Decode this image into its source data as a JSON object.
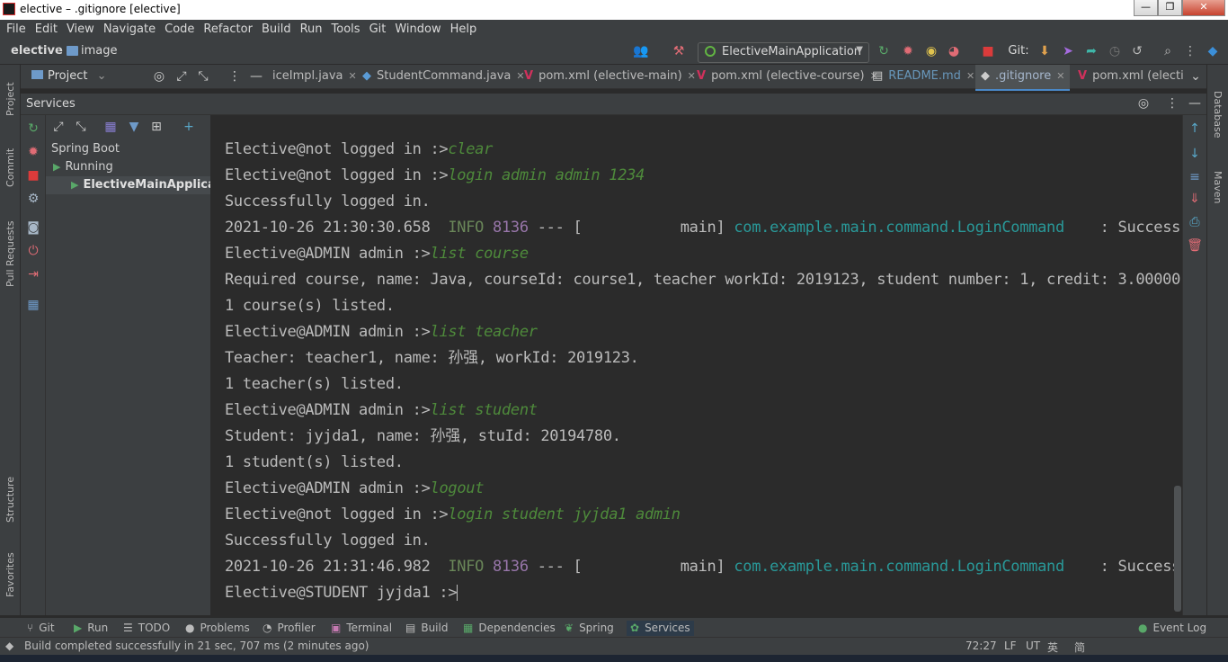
{
  "window": {
    "title": "elective – .gitignore [elective]",
    "minimize": "—",
    "maximize": "❐",
    "close": "✕"
  },
  "menu": [
    "File",
    "Edit",
    "View",
    "Navigate",
    "Code",
    "Refactor",
    "Build",
    "Run",
    "Tools",
    "Git",
    "Window",
    "Help"
  ],
  "nav": {
    "project": "elective",
    "sep": "›",
    "folder": "image",
    "run_config": "ElectiveMainApplication",
    "git_label": "Git:"
  },
  "project_panel": {
    "label": "Project"
  },
  "editor_tabs": [
    {
      "label": "iceImpl.java",
      "icon": ""
    },
    {
      "label": "StudentCommand.java",
      "icon": "◆"
    },
    {
      "label": "pom.xml (elective-main)",
      "icon": "V"
    },
    {
      "label": "pom.xml (elective-course)",
      "icon": "V"
    },
    {
      "label": "README.md",
      "icon": "▤"
    },
    {
      "label": ".gitignore",
      "icon": "◆"
    },
    {
      "label": "pom.xml (electiv",
      "icon": "V"
    }
  ],
  "left_strip": [
    "Project",
    "Commit",
    "Pull Requests",
    "Structure",
    "Favorites"
  ],
  "right_strip": [
    "Database",
    "Maven"
  ],
  "services": {
    "title": "Services",
    "tree": [
      {
        "label": "Spring Boot"
      },
      {
        "label": "Running"
      },
      {
        "label": "ElectiveMainApplicatio"
      }
    ]
  },
  "console": {
    "lines": [
      {
        "prompt": "Elective@not logged in :>",
        "cmd": "clear"
      },
      {
        "prompt": "Elective@not logged in :>",
        "cmd": "login admin admin 1234"
      },
      {
        "text": "Successfully logged in."
      },
      {
        "log_time": "2021-10-26 21:30:30.658  ",
        "log_level": "INFO",
        "log_pid": " 8136",
        "log_mid": " --- [           main] ",
        "log_class": "com.example.main.command.LoginCommand",
        "log_tail": "    : Success"
      },
      {
        "prompt": "Elective@ADMIN admin :>",
        "cmd": "list course"
      },
      {
        "text": "Required course, name: Java, courseId: course1, teacher workId: 2019123, student number: 1, credit: 3.00000"
      },
      {
        "text": "1 course(s) listed."
      },
      {
        "prompt": "Elective@ADMIN admin :>",
        "cmd": "list teacher"
      },
      {
        "text": "Teacher: teacher1, name: 孙强, workId: 2019123."
      },
      {
        "text": "1 teacher(s) listed."
      },
      {
        "prompt": "Elective@ADMIN admin :>",
        "cmd": "list student"
      },
      {
        "text": "Student: jyjda1, name: 孙强, stuId: 20194780."
      },
      {
        "text": "1 student(s) listed."
      },
      {
        "prompt": "Elective@ADMIN admin :>",
        "cmd": "logout"
      },
      {
        "prompt": "Elective@not logged in :>",
        "cmd": "login student jyjda1 admin"
      },
      {
        "text": "Successfully logged in."
      },
      {
        "log_time": "2021-10-26 21:31:46.982  ",
        "log_level": "INFO",
        "log_pid": " 8136",
        "log_mid": " --- [           main] ",
        "log_class": "com.example.main.command.LoginCommand",
        "log_tail": "    : Success"
      },
      {
        "prompt": "Elective@STUDENT jyjda1 :>",
        "cmd": ""
      }
    ]
  },
  "bottom_tabs": [
    {
      "label": "Git",
      "icon": "⑂"
    },
    {
      "label": "Run",
      "icon": "▶"
    },
    {
      "label": "TODO",
      "icon": "☰"
    },
    {
      "label": "Problems",
      "icon": "●"
    },
    {
      "label": "Profiler",
      "icon": "◔"
    },
    {
      "label": "Terminal",
      "icon": "▣"
    },
    {
      "label": "Build",
      "icon": "▤"
    },
    {
      "label": "Dependencies",
      "icon": "▦"
    },
    {
      "label": "Spring",
      "icon": "❦"
    },
    {
      "label": "Services",
      "icon": "✿"
    }
  ],
  "event_log": "Event Log",
  "status": {
    "message": "Build completed successfully in 21 sec, 707 ms (2 minutes ago)",
    "position": "72:27",
    "line_sep": "LF",
    "encoding": "UT",
    "ime1": "英",
    "ime2": "简"
  },
  "colors": {
    "bg": "#2b2b2b",
    "panel": "#3c3f41",
    "command": "#4e8a3b",
    "info": "#6a8759",
    "pid": "#9876aa",
    "class": "#299999"
  }
}
